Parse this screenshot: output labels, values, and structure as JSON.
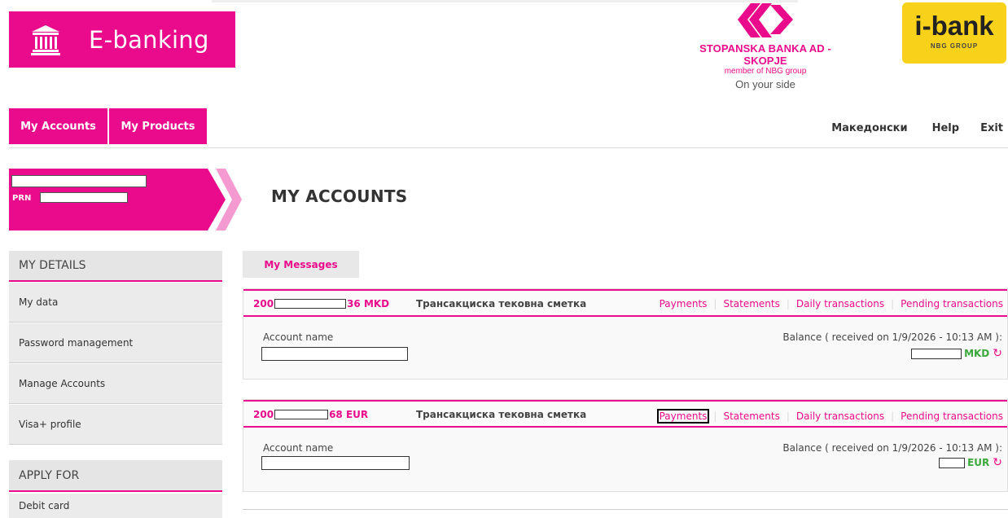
{
  "brand": {
    "logo_text": "E-banking",
    "bank_name": "STOPANSKA BANKA AD - SKOPJE",
    "member": "member of NBG group",
    "slogan": "On your side",
    "ibank_name": "i-bank",
    "ibank_group": "NBG GROUP",
    "accent": "#ea0a8c",
    "gold": "#f8d21a"
  },
  "nav": {
    "tabs": [
      "My Accounts",
      "My Products"
    ],
    "language": "Македонски",
    "help": "Help",
    "exit": "Exit"
  },
  "user": {
    "prn_label": "PRN"
  },
  "page": {
    "title": "MY ACCOUNTS",
    "messages_tab": "My Messages"
  },
  "sidebar": {
    "details_title": "MY DETAILS",
    "details_items": [
      "My data",
      "Password management",
      "Manage Accounts",
      "Visa+ profile"
    ],
    "apply_title": "APPLY FOR",
    "apply_items": [
      "Debit card"
    ]
  },
  "accounts": [
    {
      "num_prefix": "200",
      "num_suffix": "36 MKD",
      "type": "Трансакциска тековна сметка",
      "links": [
        "Payments",
        "Statements",
        "Daily transactions",
        "Pending transactions"
      ],
      "name_label": "Account name",
      "balance_label": "Balance ( received on 1/9/2026 - 10:13 AM ):",
      "currency": "MKD"
    },
    {
      "num_prefix": "200",
      "num_suffix": "68 EUR",
      "type": "Трансакциска тековна сметка",
      "links": [
        "Payments",
        "Statements",
        "Daily transactions",
        "Pending transactions"
      ],
      "name_label": "Account name",
      "balance_label": "Balance ( received on 1/9/2026 - 10:13 AM ):",
      "currency": "EUR"
    }
  ]
}
